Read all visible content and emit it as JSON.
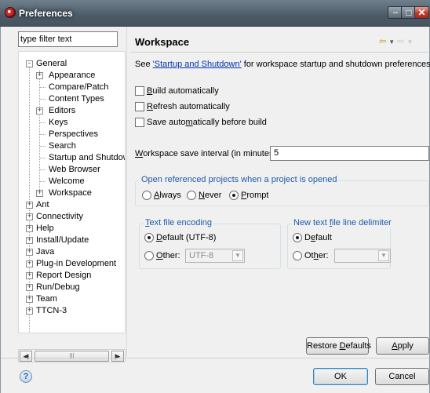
{
  "window": {
    "title": "Preferences"
  },
  "filter": {
    "value": "type filter text"
  },
  "tree": {
    "general": "General",
    "general_children": [
      "Appearance",
      "Compare/Patch",
      "Content Types",
      "Editors",
      "Keys",
      "Perspectives",
      "Search",
      "Startup and Shutdow",
      "Web Browser",
      "Welcome",
      "Workspace"
    ],
    "top_items": [
      "Ant",
      "Connectivity",
      "Help",
      "Install/Update",
      "Java",
      "Plug-in Development",
      "Report Design",
      "Run/Debug",
      "Team",
      "TTCN-3"
    ]
  },
  "page": {
    "title": "Workspace",
    "desc_prefix": "See ",
    "desc_link": "'Startup and Shutdown'",
    "desc_suffix": " for workspace startup and shutdown preferences."
  },
  "options": {
    "build_pre": "",
    "build_key": "B",
    "build_post": "uild automatically",
    "refresh_pre": "",
    "refresh_key": "R",
    "refresh_post": "efresh automatically",
    "save_pre": "Save auto",
    "save_key": "m",
    "save_post": "atically before build"
  },
  "interval": {
    "label_key": "W",
    "label_rest": "orkspace save interval (in minutes):",
    "value": "5"
  },
  "open_refs": {
    "legend": "Open referenced projects when a project is opened",
    "always_key": "A",
    "always_rest": "lways",
    "never_key": "N",
    "never_rest": "ever",
    "prompt_key": "P",
    "prompt_rest": "rompt",
    "selected": "Prompt"
  },
  "encoding": {
    "legend_key": "T",
    "legend_rest": "ext file encoding",
    "default_key": "D",
    "default_rest": "efault (UTF-8)",
    "other_key": "O",
    "other_rest": "ther:",
    "combo_value": "UTF-8",
    "selected": "Default"
  },
  "delimiter": {
    "legend_pre": "New text ",
    "legend_key": "f",
    "legend_rest": "ile line delimiter",
    "default_pre": "D",
    "default_key": "e",
    "default_rest": "fault",
    "other_pre": "Ot",
    "other_key": "h",
    "other_rest": "er:",
    "combo_value": "",
    "selected": "Default"
  },
  "buttons": {
    "restore_pre": "Restore ",
    "restore_key": "D",
    "restore_rest": "efaults",
    "apply_key": "A",
    "apply_rest": "pply",
    "ok": "OK",
    "cancel": "Cancel"
  },
  "colors": {
    "group_legend": "#1e5aa8",
    "link": "#0033aa",
    "nav_back": "#c98f00"
  },
  "icons": [
    "eclipse-app-icon",
    "minimize-icon",
    "maximize-icon",
    "close-icon",
    "back-arrow-icon",
    "forward-arrow-icon",
    "dropdown-icon",
    "help-icon"
  ]
}
